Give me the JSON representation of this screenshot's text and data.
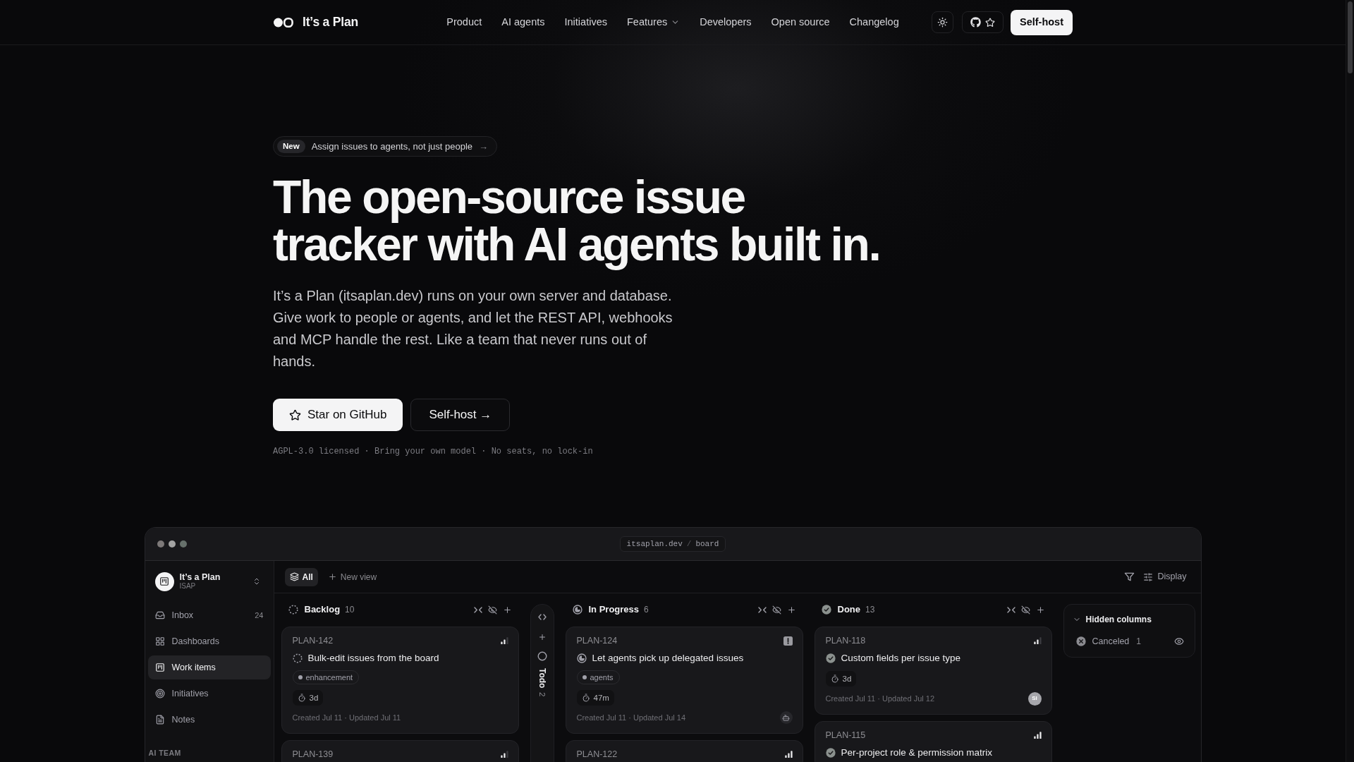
{
  "nav": {
    "brand": "It’s a Plan",
    "links": [
      {
        "label": "Product",
        "dropdown": false
      },
      {
        "label": "AI agents",
        "dropdown": false
      },
      {
        "label": "Initiatives",
        "dropdown": false
      },
      {
        "label": "Features",
        "dropdown": true
      },
      {
        "label": "Developers",
        "dropdown": false
      },
      {
        "label": "Open source",
        "dropdown": false
      },
      {
        "label": "Changelog",
        "dropdown": false
      }
    ],
    "cta": "Self-host"
  },
  "hero": {
    "badge": {
      "tag": "New",
      "text": "Assign issues to agents, not just people",
      "arrow": "→"
    },
    "title_lines": [
      "The open-source issue",
      "tracker with AI agents built in."
    ],
    "description": "It’s a Plan (itsaplan.dev) runs on your own server and database. Give work to people or agents, and let the REST API, webhooks and MCP handle the rest. Like a team that never runs out of hands.",
    "buttons": [
      {
        "kind": "primary",
        "label": "Star on GitHub"
      },
      {
        "kind": "secondary",
        "label": "Self-host →"
      }
    ],
    "footnote": "AGPL-3.0 licensed · Bring your own model · No seats, no lock-in"
  },
  "app_window": {
    "address": {
      "host": "itsaplan.dev",
      "separator": "/",
      "path": "board"
    },
    "sidebar": {
      "workspace": {
        "name": "It’s a Plan",
        "code": "ISAP"
      },
      "items": [
        {
          "label": "Inbox",
          "count": "24",
          "selected": false
        },
        {
          "label": "Dashboards",
          "selected": false
        },
        {
          "label": "Work items",
          "selected": true
        },
        {
          "label": "Initiatives",
          "selected": false
        },
        {
          "label": "Notes",
          "selected": false
        }
      ],
      "section_label": "AI TEAM"
    },
    "toolbar": {
      "views": [
        {
          "label": "All",
          "selected": true
        }
      ],
      "new_view": "New view",
      "display": "Display"
    },
    "columns": [
      {
        "kind": "backlog",
        "name": "Backlog",
        "count": "10",
        "collapsed": false,
        "cards": [
          {
            "id": "PLAN-142",
            "priority": {
              "kind": "bars",
              "level": 0.67
            },
            "title": "Bulk-edit issues from the board",
            "tags": [
              "enhancement"
            ],
            "estimate": "3d",
            "meta": "Created Jul 11 · Updated Jul 11"
          },
          {
            "id": "PLAN-139",
            "priority": {
              "kind": "bars",
              "level": 0.67
            }
          }
        ]
      },
      {
        "kind": "todo",
        "name": "Todo",
        "count": "2",
        "collapsed": true
      },
      {
        "kind": "in_progress",
        "name": "In Progress",
        "count": "6",
        "collapsed": false,
        "cards": [
          {
            "id": "PLAN-124",
            "priority": {
              "kind": "urgent"
            },
            "title": "Let agents pick up delegated issues",
            "tags": [
              "agents"
            ],
            "estimate": "47m",
            "meta": "Created Jul 11 · Updated Jul 14",
            "assignee": {
              "kind": "agent"
            }
          },
          {
            "id": "PLAN-122",
            "priority": {
              "kind": "bars",
              "level": 1
            }
          }
        ]
      },
      {
        "kind": "done",
        "name": "Done",
        "count": "13",
        "collapsed": false,
        "cards": [
          {
            "id": "PLAN-118",
            "priority": {
              "kind": "bars",
              "level": 0.67
            },
            "title": "Custom fields per issue type",
            "estimate": "3d",
            "meta": "Created Jul 11 · Updated Jul 12",
            "assignee": {
              "kind": "person",
              "initials": "SI"
            }
          },
          {
            "id": "PLAN-115",
            "priority": {
              "kind": "bars",
              "level": 1
            },
            "title": "Per-project role & permission matrix"
          }
        ]
      }
    ],
    "hidden_columns": {
      "title": "Hidden columns",
      "expanded": true,
      "items": [
        {
          "kind": "canceled",
          "name": "Canceled",
          "count": "1"
        }
      ]
    }
  }
}
